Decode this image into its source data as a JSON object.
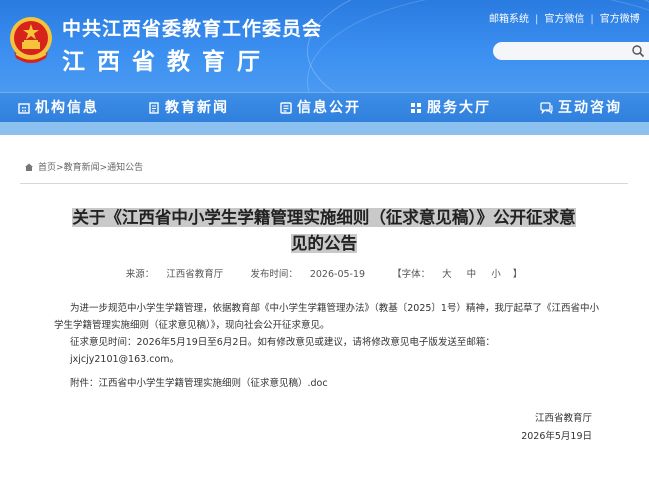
{
  "header": {
    "title_cn": "中共江西省委教育工作委员会",
    "title_main": "江西省教育厅",
    "top_links": [
      "邮箱系统",
      "官方微信",
      "官方微博"
    ],
    "search_placeholder": ""
  },
  "nav": {
    "items": [
      {
        "label": "机构信息",
        "icon": "building-icon"
      },
      {
        "label": "教育新闻",
        "icon": "document-icon"
      },
      {
        "label": "信息公开",
        "icon": "info-icon"
      },
      {
        "label": "服务大厅",
        "icon": "grid-icon"
      },
      {
        "label": "互动咨询",
        "icon": "chat-icon"
      }
    ]
  },
  "breadcrumb": {
    "home": "首页",
    "sep": ">",
    "level1": "教育新闻",
    "level2": "通知公告"
  },
  "article": {
    "title_line1": "关于《江西省中小学生学籍管理实施细则（征求意见稿）》公开征求意",
    "title_line2": "见的公告",
    "source_label": "来源：",
    "source_value": "江西省教育厅",
    "date_label": "发布时间：",
    "date_value": "2026-05-19",
    "font_label": "【字体：",
    "font_large": "大",
    "font_medium": "中",
    "font_small": "小",
    "font_close": "】",
    "paragraph1": "为进一步规范中小学生学籍管理，依据教育部《中小学生学籍管理办法》（教基〔2025〕1号）精神，我厅起草了《江西省中小学生学籍管理实施细则（征求意见稿）》，现向社会公开征求意见。",
    "paragraph2": "征求意见时间：2026年5月19日至6月2日。如有修改意见或建议，请将修改意见电子版发送至邮箱：jxjcjy2101@163.com。",
    "attachment": "附件：江西省中小学生学籍管理实施细则（征求意见稿）.doc",
    "signature_org": "江西省教育厅",
    "signature_date": "2026年5月19日"
  },
  "colors": {
    "header_blue": "#2f82e4",
    "nav_blue": "#3485e0",
    "band_light": "#8cc0ee",
    "emblem_red": "#d6241c",
    "emblem_gold": "#f5c43a"
  }
}
